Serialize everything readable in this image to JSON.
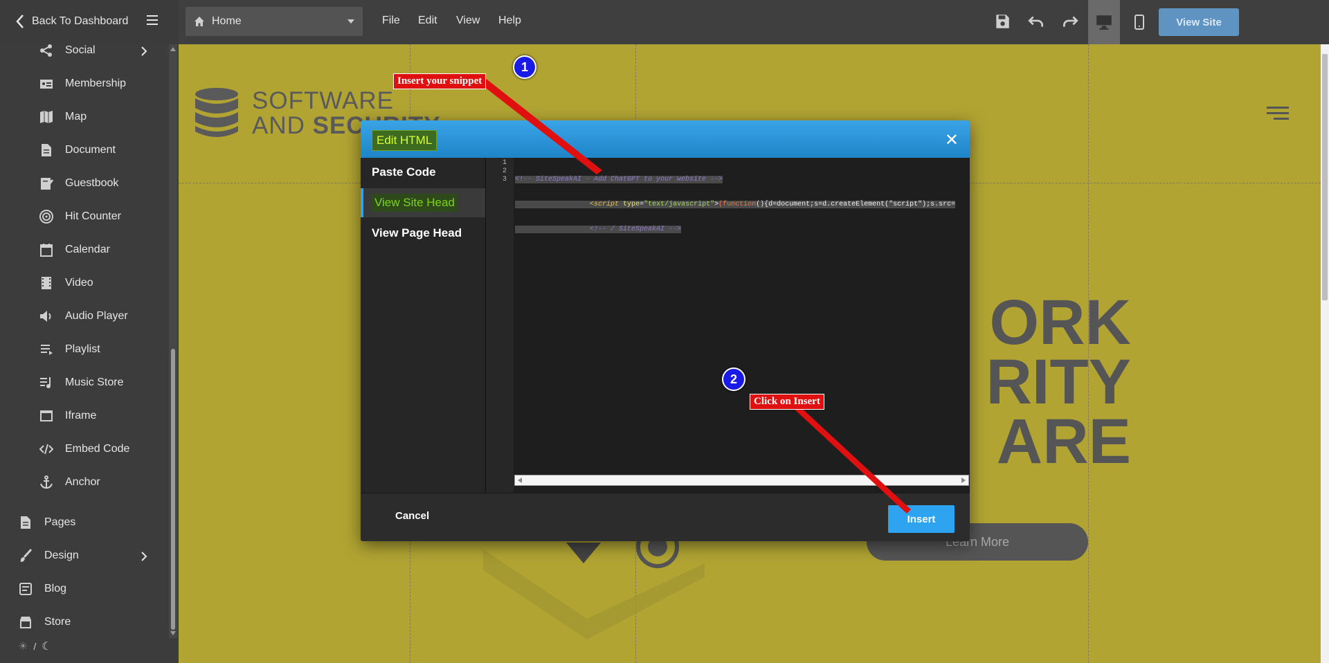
{
  "topbar": {
    "back_label": "Back To Dashboard",
    "page_select": "Home",
    "menus": [
      "File",
      "Edit",
      "View",
      "Help"
    ],
    "view_site_label": "View Site"
  },
  "sidebar": {
    "items": [
      {
        "label": "Social",
        "icon": "share-icon"
      },
      {
        "label": "Membership",
        "icon": "id-card-icon"
      },
      {
        "label": "Map",
        "icon": "map-icon"
      },
      {
        "label": "Document",
        "icon": "document-icon"
      },
      {
        "label": "Guestbook",
        "icon": "guestbook-icon"
      },
      {
        "label": "Hit Counter",
        "icon": "target-icon"
      },
      {
        "label": "Calendar",
        "icon": "calendar-icon"
      },
      {
        "label": "Video",
        "icon": "film-icon"
      },
      {
        "label": "Audio Player",
        "icon": "speaker-icon"
      },
      {
        "label": "Playlist",
        "icon": "playlist-icon"
      },
      {
        "label": "Music Store",
        "icon": "music-store-icon"
      },
      {
        "label": "Iframe",
        "icon": "iframe-icon"
      },
      {
        "label": "Embed Code",
        "icon": "code-icon"
      },
      {
        "label": "Anchor",
        "icon": "anchor-icon"
      }
    ],
    "main_items": [
      {
        "label": "Pages",
        "icon": "page-icon"
      },
      {
        "label": "Design",
        "icon": "brush-icon"
      },
      {
        "label": "Blog",
        "icon": "blog-icon"
      },
      {
        "label": "Store",
        "icon": "store-icon"
      }
    ],
    "theme_separator": "/"
  },
  "canvas": {
    "logo_line1": "SOFTWARE",
    "logo_line2a": "AND ",
    "logo_line2b": "SECURITY",
    "hero_lines": [
      "ORK",
      "RITY",
      "ARE"
    ],
    "learn_more": "Learn More"
  },
  "modal": {
    "title": "Edit HTML",
    "tabs": [
      "Paste Code",
      "View Site Head",
      "View Page Head"
    ],
    "line_numbers": [
      "1",
      "2",
      "3"
    ],
    "code": {
      "line1": "<!-- SiteSpeakAI - Add ChatGPT to your website -->",
      "line2_tag": "<script",
      "line2_attr": " type",
      "line2_eq": "=",
      "line2_str": "\"text/javascript\"",
      "line2_gt": ">",
      "line2_fn": "(function",
      "line2_rest": "(){d=document;s=d.createElement(\"script\");s.src=",
      "line3": "<!-- / SiteSpeakAI -->"
    },
    "cancel_label": "Cancel",
    "insert_label": "Insert"
  },
  "annotations": {
    "step1_num": "1",
    "step1_label": "Insert your snippet",
    "step2_num": "2",
    "step2_label": "Click on Insert"
  }
}
